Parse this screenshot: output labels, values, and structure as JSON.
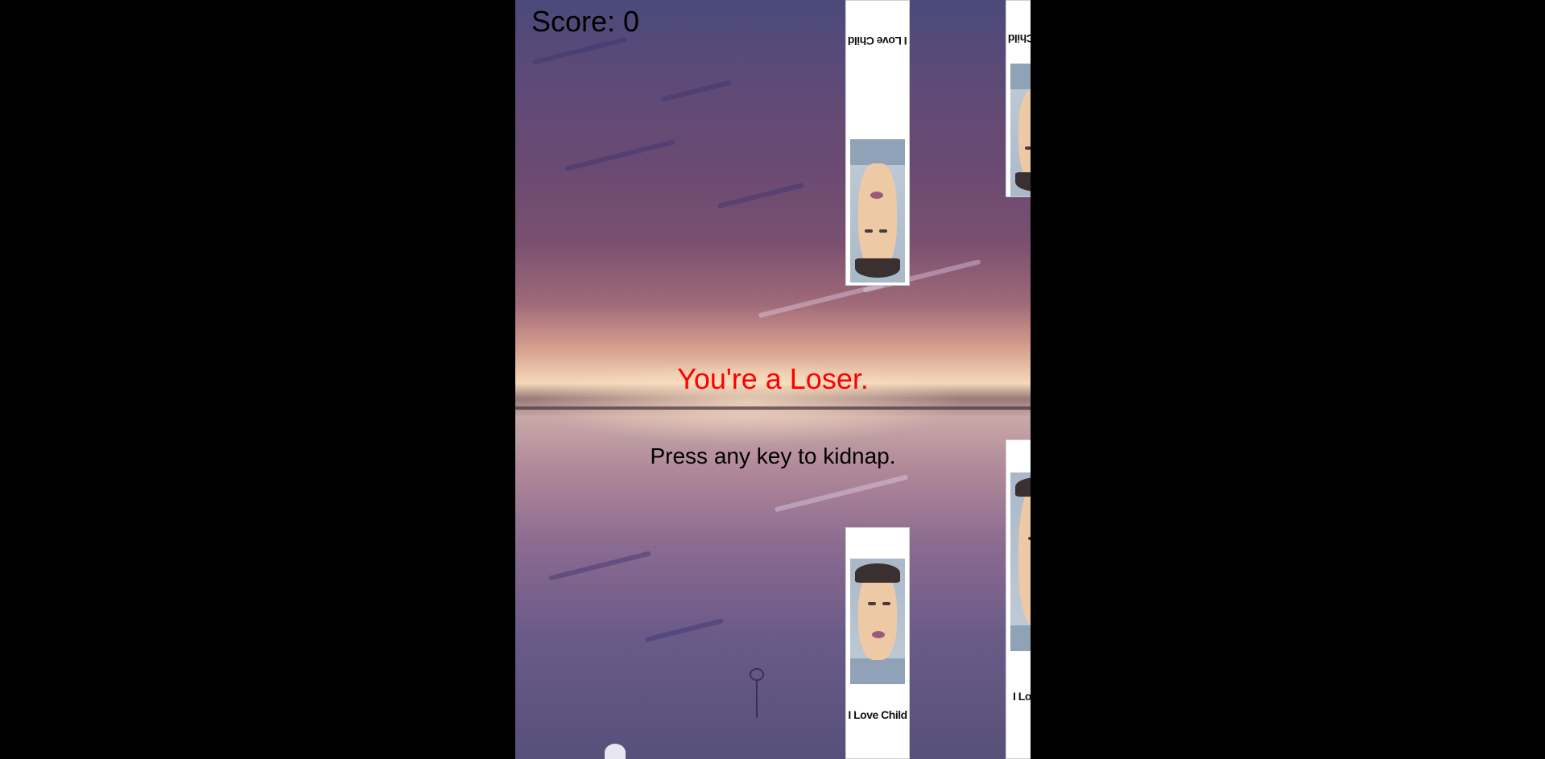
{
  "hud": {
    "score_label": "Score: 0"
  },
  "game_over": {
    "title": "You're a Loser.",
    "hint": "Press any key to kidnap."
  },
  "pipes": {
    "label": "I Love Child"
  },
  "colors": {
    "page_background": "#000000",
    "title_color": "#ff0000",
    "text_color": "#000000",
    "pipe_color": "#ffffff"
  }
}
